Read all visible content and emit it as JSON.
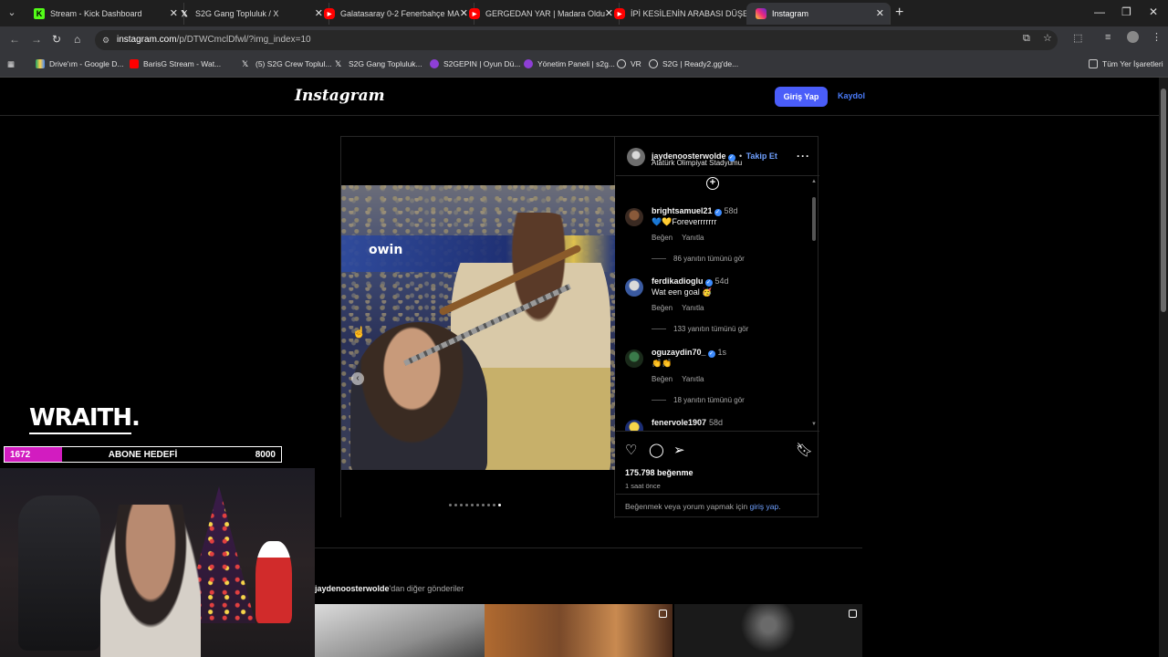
{
  "browser": {
    "tabs": [
      {
        "label": "Stream - Kick Dashboard",
        "favicon": "kick-icon",
        "color": "#53fc18"
      },
      {
        "label": "S2G Gang Topluluk / X",
        "favicon": "x-icon",
        "color": "#ffffff"
      },
      {
        "label": "Galatasaray 0-2 Fenerbahçe MA",
        "favicon": "youtube-icon",
        "color": "#ff0000"
      },
      {
        "label": "GERGEDAN YAR | Madara Oldu",
        "favicon": "youtube-icon",
        "color": "#ff0000"
      },
      {
        "label": "İPİ KESİLENİN ARABASI DÜŞER",
        "favicon": "youtube-icon",
        "color": "#ff0000"
      },
      {
        "label": "Instagram",
        "favicon": "instagram-icon",
        "color": "#e1306c"
      }
    ],
    "url_site": "instagram.com",
    "url_rest": "/p/DTWCmclDfwl/?img_index=10",
    "bookmarks": [
      "Drive'ım - Google D...",
      "BarisG Stream - Wat...",
      "(5) S2G Crew Toplul...",
      "S2G Gang Topluluk...",
      "S2GEPIN | Oyun Dü...",
      "Yönetim Paneli | s2g...",
      "VR",
      "S2G | Ready2.gg'de..."
    ],
    "all_bookmarks": "Tüm Yer İşaretleri"
  },
  "instagram": {
    "logo": "Instagram",
    "login_label": "Giriş Yap",
    "signup_label": "Kaydol",
    "post": {
      "author": "jaydenoosterwolde",
      "follow_label": "Takip Et",
      "separator": "•",
      "location": "Atatürk Olimpiyat Stadyumu",
      "banner_text": "owin",
      "comments": [
        {
          "user": "brightsamuel21",
          "time": "58d",
          "text": "💙💛Foreverrrrrrr",
          "like": "Beğen",
          "reply": "Yanıtla",
          "replies": "86 yanıtın tümünü gör"
        },
        {
          "user": "ferdikadioglu",
          "time": "54d",
          "text": "Wat een goal 🥳",
          "like": "Beğen",
          "reply": "Yanıtla",
          "replies": "133 yanıtın tümünü gör"
        },
        {
          "user": "oguzaydin70_",
          "time": "1s",
          "text": "👏👏",
          "like": "Beğen",
          "reply": "Yanıtla",
          "replies": "18 yanıtın tümünü gör"
        },
        {
          "user": "fenervole1907",
          "time": "58d",
          "text": "",
          "like": "",
          "reply": "",
          "replies": ""
        }
      ],
      "likes": "175.798 beğenme",
      "posted": "1 saat önce",
      "prompt_text": "Beğenmek veya yorum yapmak için ",
      "prompt_link": "giriş yap",
      "prompt_end": ".",
      "carousel_index": 10,
      "carousel_total": 10
    },
    "more_posts_user": "jaydenoosterwolde",
    "more_posts_suffix": "'dan diğer gönderiler"
  },
  "stream_overlay": {
    "brand": "WRAITH.",
    "goal_current": "1672",
    "goal_label": "ABONE HEDEFİ",
    "goal_target": "8000",
    "goal_fraction": 0.209,
    "accent": "#d21cc0"
  }
}
